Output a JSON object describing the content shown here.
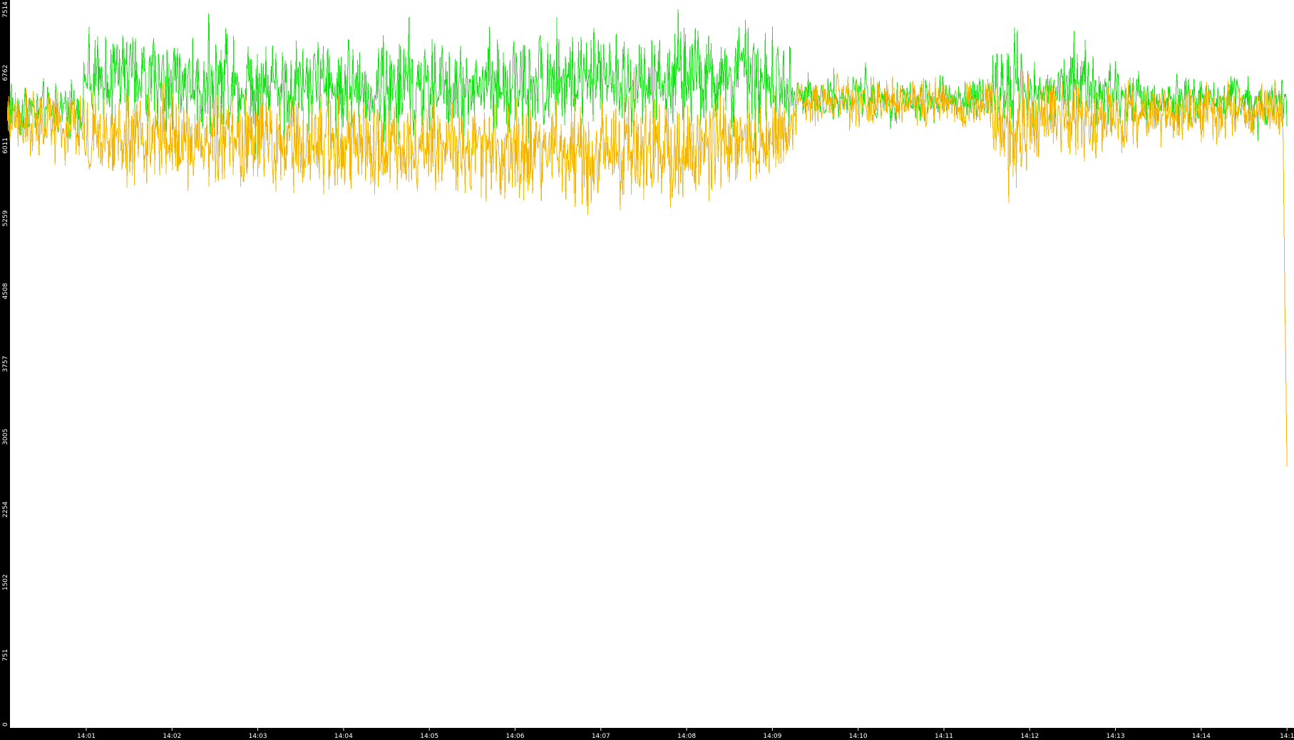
{
  "chart_data": {
    "type": "line",
    "title": "",
    "xlabel": "",
    "ylabel": "",
    "ylim": [
      0,
      7514
    ],
    "y_ticks": [
      "0",
      "751",
      "1502",
      "2254",
      "3005",
      "3757",
      "4508",
      "5259",
      "6011",
      "6762",
      "7514"
    ],
    "x_ticks": [
      "14:01",
      "14:02",
      "14:03",
      "14:04",
      "14:05",
      "14:06",
      "14:07",
      "14:08",
      "14:09",
      "14:10",
      "14:11",
      "14:12",
      "14:13",
      "14:14",
      "14:1"
    ],
    "x_tick_minutes": [
      1,
      2,
      3,
      4,
      5,
      6,
      7,
      8,
      9,
      10,
      11,
      12,
      13,
      14,
      15
    ],
    "xlim_minutes": [
      0.08,
      15.0
    ],
    "grid": false,
    "legend": "none",
    "series": [
      {
        "color": "#18e018",
        "samples_per_minute": 130,
        "profile": [
          {
            "t": 0.1,
            "mean": 6400,
            "amp": 330
          },
          {
            "t": 0.95,
            "mean": 6380,
            "amp": 340
          },
          {
            "t": 1.0,
            "mean": 6700,
            "amp": 600
          },
          {
            "t": 3.0,
            "mean": 6650,
            "amp": 620
          },
          {
            "t": 5.0,
            "mean": 6600,
            "amp": 620
          },
          {
            "t": 7.0,
            "mean": 6700,
            "amp": 650
          },
          {
            "t": 9.2,
            "mean": 6680,
            "amp": 620
          },
          {
            "t": 9.25,
            "mean": 6520,
            "amp": 260
          },
          {
            "t": 11.4,
            "mean": 6480,
            "amp": 300
          },
          {
            "t": 11.8,
            "mean": 6650,
            "amp": 650
          },
          {
            "t": 12.2,
            "mean": 6500,
            "amp": 320
          },
          {
            "t": 12.5,
            "mean": 6700,
            "amp": 600
          },
          {
            "t": 13.2,
            "mean": 6500,
            "amp": 320
          },
          {
            "t": 15.0,
            "mean": 6450,
            "amp": 300
          }
        ]
      },
      {
        "color": "#f4b400",
        "samples_per_minute": 160,
        "profile": [
          {
            "t": 0.1,
            "mean": 6300,
            "amp": 380
          },
          {
            "t": 1.0,
            "mean": 6100,
            "amp": 520
          },
          {
            "t": 3.0,
            "mean": 6050,
            "amp": 600
          },
          {
            "t": 5.0,
            "mean": 6000,
            "amp": 560
          },
          {
            "t": 7.0,
            "mean": 5900,
            "amp": 650
          },
          {
            "t": 8.5,
            "mean": 6000,
            "amp": 600
          },
          {
            "t": 9.2,
            "mean": 6100,
            "amp": 420
          },
          {
            "t": 9.3,
            "mean": 6480,
            "amp": 280
          },
          {
            "t": 11.5,
            "mean": 6450,
            "amp": 300
          },
          {
            "t": 11.8,
            "mean": 6100,
            "amp": 800
          },
          {
            "t": 12.2,
            "mean": 6350,
            "amp": 380
          },
          {
            "t": 12.6,
            "mean": 6250,
            "amp": 500
          },
          {
            "t": 13.5,
            "mean": 6350,
            "amp": 350
          },
          {
            "t": 14.95,
            "mean": 6400,
            "amp": 350
          },
          {
            "t": 15.0,
            "mean": 2700,
            "amp": 0
          }
        ]
      }
    ]
  }
}
